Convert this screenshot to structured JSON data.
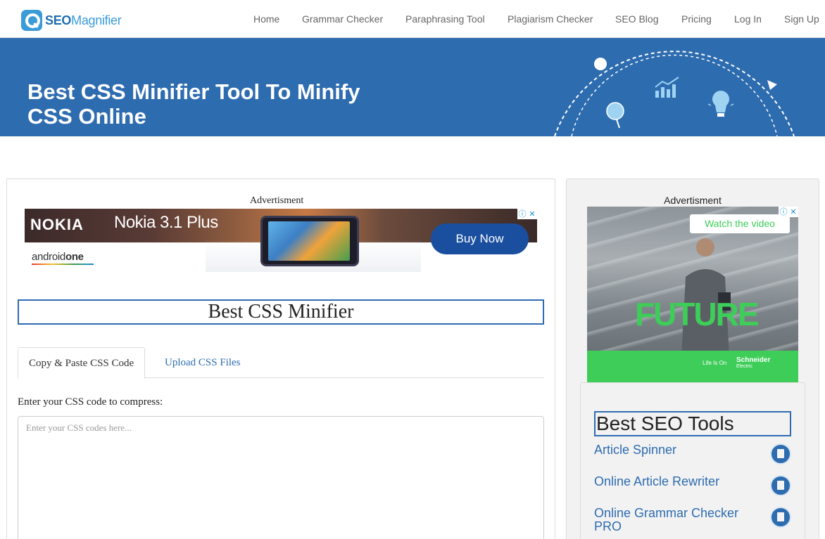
{
  "header": {
    "logo": {
      "seo": "SEO",
      "magnifier": "Magnifier"
    },
    "nav": [
      "Home",
      "Grammar Checker",
      "Paraphrasing Tool",
      "Plagiarism Checker",
      "SEO Blog",
      "Pricing",
      "Log In",
      "Sign Up"
    ]
  },
  "banner": {
    "title_line1": "Best CSS Minifier Tool To Minify",
    "title_line2": "CSS Online"
  },
  "main": {
    "ad_label": "Advertisment",
    "ad": {
      "brand": "NOKIA",
      "model": "Nokia 3.1 Plus",
      "android": "android",
      "android_one": "one",
      "cta": "Buy Now",
      "info_icon": "ⓘ",
      "close_icon": "✕"
    },
    "tool_title": "Best CSS Minifier",
    "tabs": [
      {
        "label": "Copy & Paste CSS Code",
        "active": true
      },
      {
        "label": "Upload CSS Files",
        "active": false
      }
    ],
    "input_label": "Enter your CSS code to compress:",
    "textarea_placeholder": "Enter your CSS codes here...",
    "textarea_value": ""
  },
  "sidebar": {
    "ad_label": "Advertisment",
    "ad": {
      "cta": "Watch the video",
      "headline": "FUTURE",
      "tagline": "Life Is On",
      "brand": "Schneider",
      "brand_sub": "Electric",
      "info_icon": "ⓘ",
      "close_icon": "✕"
    },
    "tools_title": "Best SEO Tools",
    "tools": [
      {
        "label": "Article Spinner",
        "icon": "shield-doc-icon"
      },
      {
        "label": "Online Article Rewriter",
        "icon": "notepad-icon"
      },
      {
        "label": "Online Grammar Checker PRO",
        "icon": "check-doc-icon"
      }
    ]
  },
  "colors": {
    "brand_blue": "#2e6cb0",
    "logo_light_blue": "#3a9bd9",
    "ad_green": "#3dcd58",
    "nokia_button": "#1a4fa0"
  }
}
